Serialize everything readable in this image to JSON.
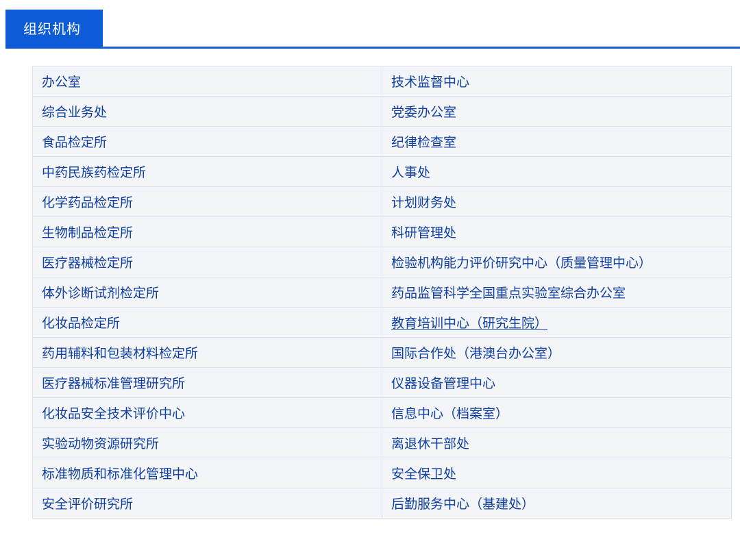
{
  "header": {
    "title": "组织机构"
  },
  "rows": [
    {
      "left": "办公室",
      "right": "技术监督中心"
    },
    {
      "left": "综合业务处",
      "right": "党委办公室"
    },
    {
      "left": "食品检定所",
      "right": "纪律检查室"
    },
    {
      "left": "中药民族药检定所",
      "right": "人事处"
    },
    {
      "left": "化学药品检定所",
      "right": "计划财务处"
    },
    {
      "left": "生物制品检定所",
      "right": "科研管理处"
    },
    {
      "left": "医疗器械检定所",
      "right": "检验机构能力评价研究中心（质量管理中心）"
    },
    {
      "left": "体外诊断试剂检定所",
      "right": "药品监管科学全国重点实验室综合办公室"
    },
    {
      "left": "化妆品检定所",
      "right": "教育培训中心（研究生院）"
    },
    {
      "left": "药用辅料和包装材料检定所",
      "right": "国际合作处（港澳台办公室）"
    },
    {
      "left": "医疗器械标准管理研究所",
      "right": "仪器设备管理中心"
    },
    {
      "left": "化妆品安全技术评价中心",
      "right": "信息中心（档案室）"
    },
    {
      "left": "实验动物资源研究所",
      "right": "离退休干部处"
    },
    {
      "left": "标准物质和标准化管理中心",
      "right": "安全保卫处"
    },
    {
      "left": "安全评价研究所",
      "right": "后勤服务中心（基建处）"
    }
  ],
  "colors": {
    "accent": "#0d5bd7",
    "link_text": "#0f3f9f",
    "table_bg": "#f3f5f9",
    "border": "#dde2ea"
  }
}
